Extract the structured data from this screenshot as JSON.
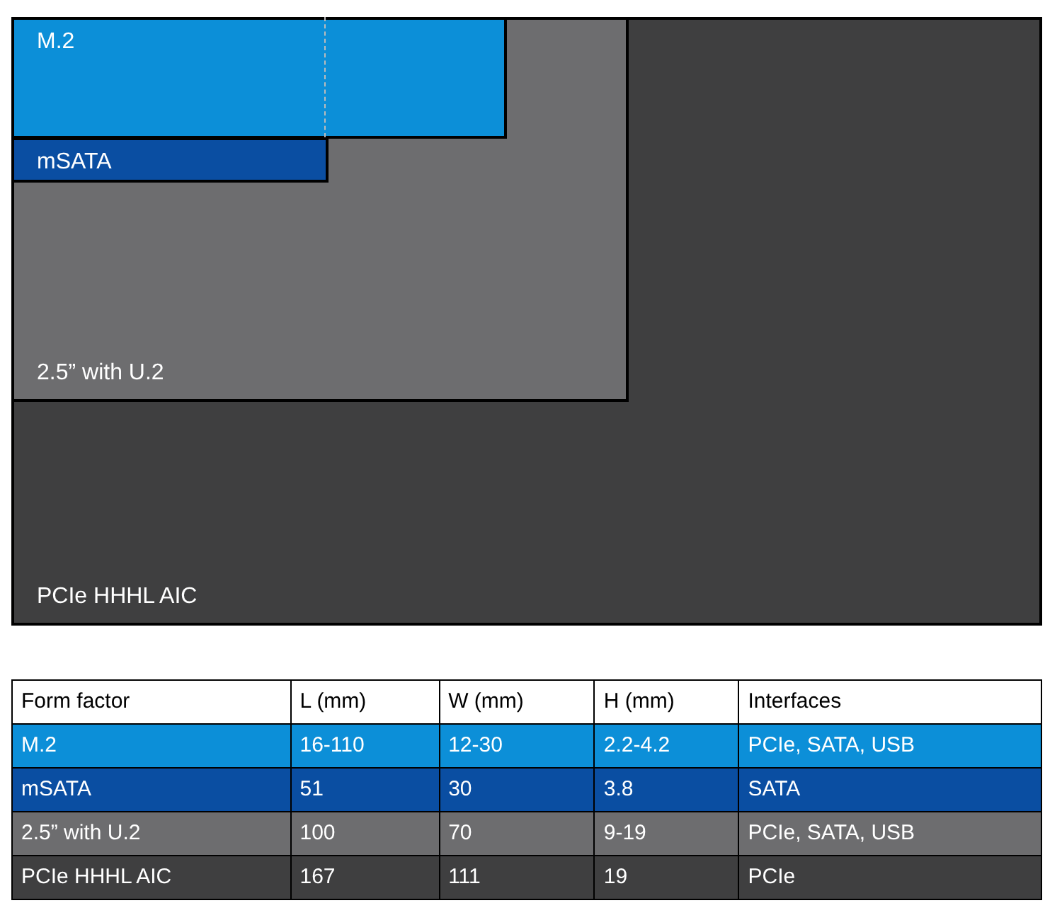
{
  "diagram": {
    "form_factors": [
      {
        "name": "M.2",
        "color": "#0c8fd8"
      },
      {
        "name": "mSATA",
        "color": "#0a4ea2"
      },
      {
        "name": "2.5” with U.2",
        "color": "#6d6d6f"
      },
      {
        "name": "PCIe HHHL AIC",
        "color": "#3f3f40"
      }
    ]
  },
  "table": {
    "columns": [
      "Form factor",
      "L (mm)",
      "W (mm)",
      "H (mm)",
      "Interfaces"
    ],
    "rows": [
      {
        "color": "#0c8fd8",
        "cells": [
          "M.2",
          "16-110",
          "12-30",
          "2.2-4.2",
          "PCIe, SATA, USB"
        ]
      },
      {
        "color": "#0a4ea2",
        "cells": [
          "mSATA",
          "51",
          "30",
          "3.8",
          "SATA"
        ]
      },
      {
        "color": "#6d6d6f",
        "cells": [
          "2.5” with U.2",
          "100",
          "70",
          "9-19",
          "PCIe, SATA, USB"
        ]
      },
      {
        "color": "#3f3f40",
        "cells": [
          "PCIe HHHL AIC",
          "167",
          "111",
          "19",
          "PCIe"
        ]
      }
    ]
  }
}
